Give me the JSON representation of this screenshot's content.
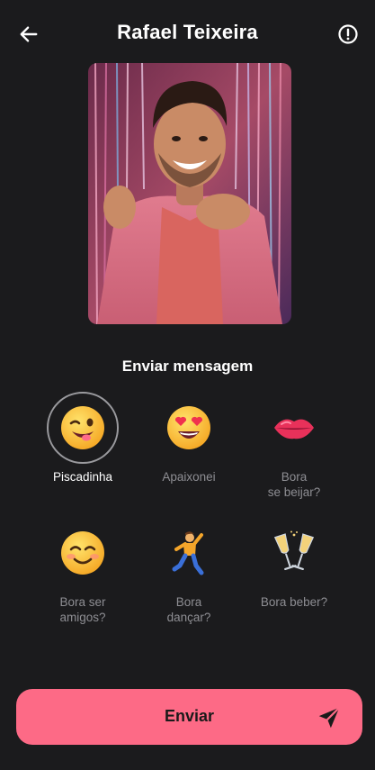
{
  "header": {
    "title": "Rafael Teixeira",
    "back_icon": "arrow-left-icon",
    "report_icon": "alert-circle-icon"
  },
  "photo": {
    "description_icon": "profile-photo"
  },
  "section_title": "Enviar mensagem",
  "reactions": [
    {
      "label": "Piscadinha",
      "icon": "winking-face-icon",
      "selected": true
    },
    {
      "label": "Apaixonei",
      "icon": "heart-eyes-face-icon",
      "selected": false
    },
    {
      "label_line1": "Bora",
      "label_line2": "se beijar?",
      "icon": "lips-icon",
      "selected": false
    },
    {
      "label_line1": "Bora ser",
      "label_line2": "amigos?",
      "icon": "smiling-face-icon",
      "selected": false
    },
    {
      "label_line1": "Bora",
      "label_line2": "dançar?",
      "icon": "dancing-man-icon",
      "selected": false
    },
    {
      "label": "Bora beber?",
      "icon": "champagne-glasses-icon",
      "selected": false
    }
  ],
  "send_button": {
    "label": "Enviar",
    "icon": "send-plane-icon"
  },
  "colors": {
    "background": "#1b1b1d",
    "accent": "#fd6a86",
    "muted_text": "#8e8e93"
  }
}
